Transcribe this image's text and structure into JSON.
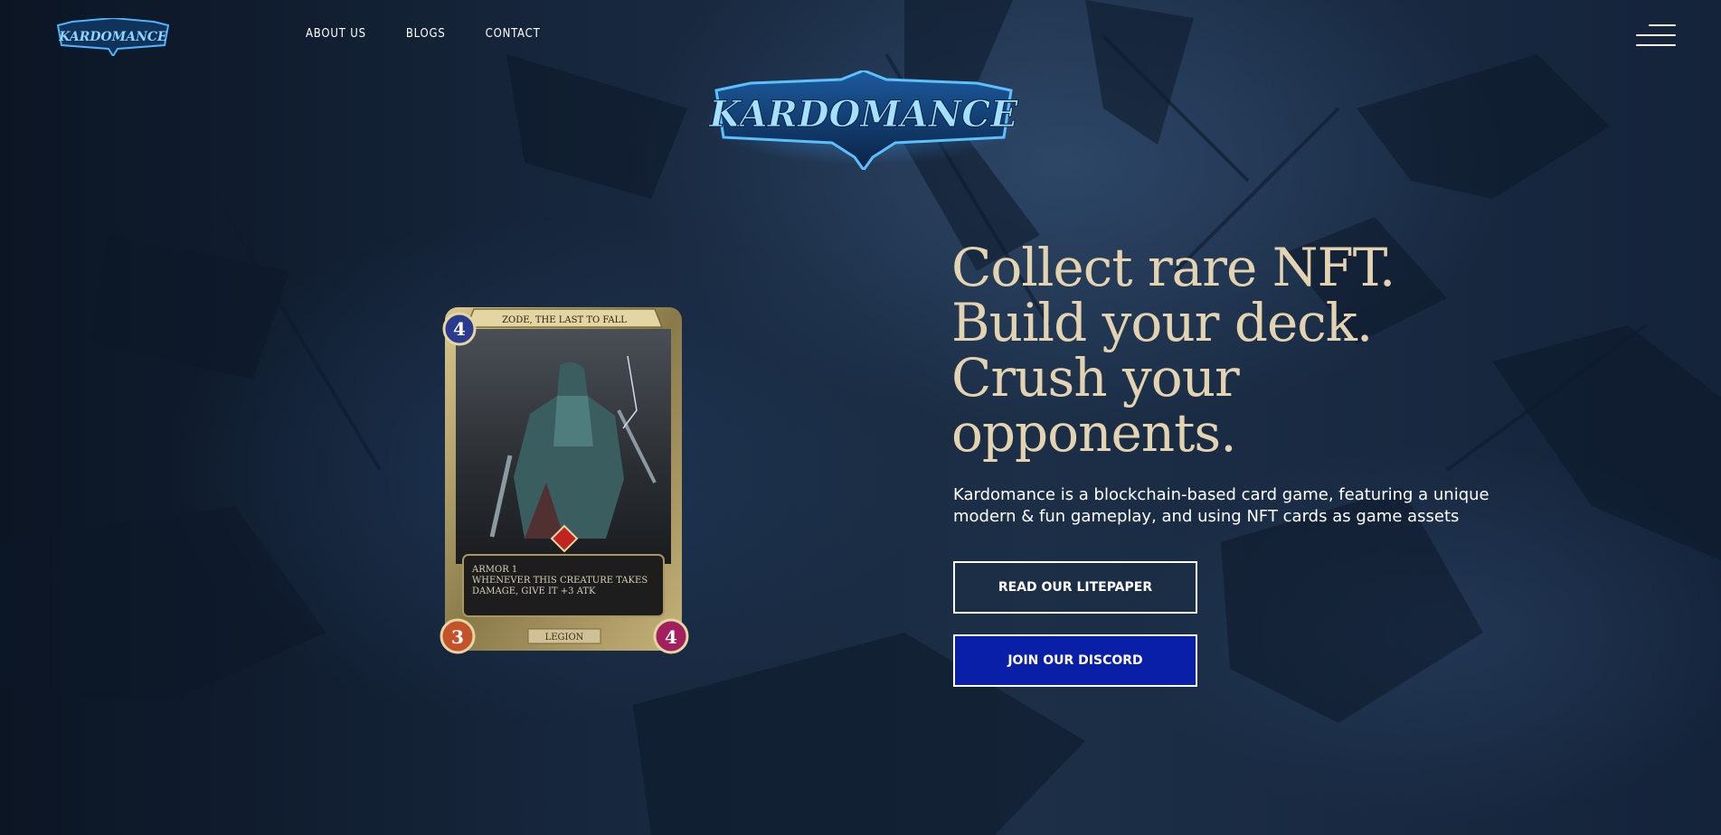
{
  "header": {
    "logo_text": "KARDOMANCE",
    "nav": [
      {
        "label": "ABOUT US"
      },
      {
        "label": "BLOGS"
      },
      {
        "label": "CONTACT"
      }
    ],
    "menu_icon": "hamburger-menu-icon"
  },
  "hero": {
    "logo_text": "KARDOMANCE",
    "heading_lines": [
      "Collect rare NFT.",
      "Build your deck.",
      "Crush your",
      "opponents."
    ],
    "description": "Kardomance is a blockchain-based card game, featuring a unique modern & fun gameplay, and using NFT cards as game assets",
    "buttons": {
      "litepaper": "READ OUR LITEPAPER",
      "discord": "JOIN OUR DISCORD"
    }
  },
  "card": {
    "name": "ZODE, THE LAST TO FALL",
    "cost": "4",
    "ability_line1": "ARMOR 1",
    "ability_line2": "WHENEVER THIS CREATURE TAKES",
    "ability_line3": "DAMAGE, GIVE IT +3 ATK",
    "attack": "3",
    "health": "4",
    "faction": "LEGION"
  },
  "colors": {
    "heading": "#e3d3b1",
    "discord_button": "#0a1fa8",
    "logo_blue": "#4fb3ff"
  }
}
